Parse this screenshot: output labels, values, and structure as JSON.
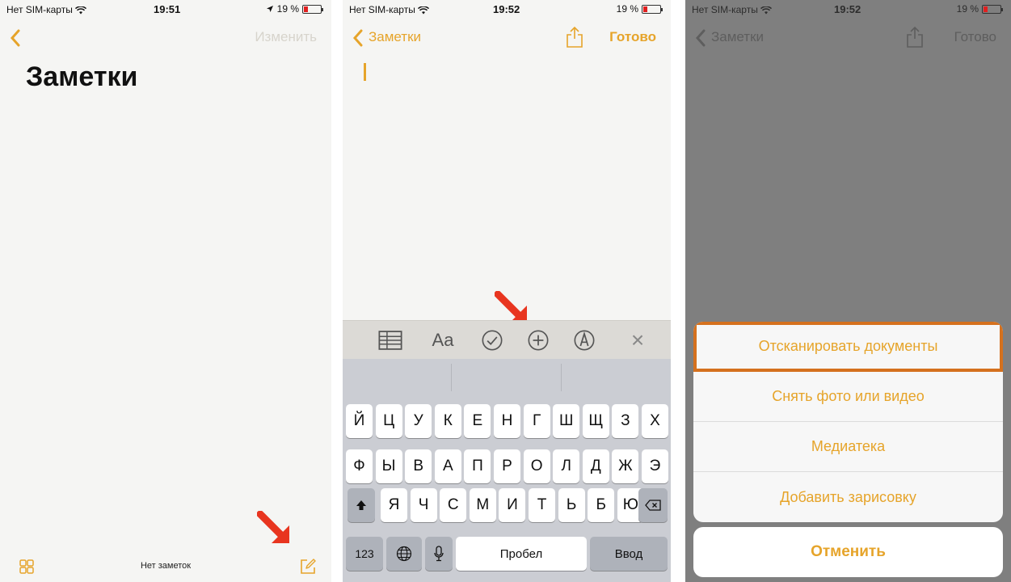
{
  "status": {
    "carrier": "Нет SIM-карты",
    "battery": "19 %",
    "time1": "19:51",
    "time2": "19:52",
    "time3": "19:52"
  },
  "screen1": {
    "edit_label": "Изменить",
    "title": "Заметки",
    "empty_label": "Нет заметок"
  },
  "screen2": {
    "back_label": "Заметки",
    "done_label": "Готово",
    "format_aa": "Aa",
    "keyboard": {
      "row1": [
        "Й",
        "Ц",
        "У",
        "К",
        "Е",
        "Н",
        "Г",
        "Ш",
        "Щ",
        "З",
        "Х"
      ],
      "row2": [
        "Ф",
        "Ы",
        "В",
        "А",
        "П",
        "Р",
        "О",
        "Л",
        "Д",
        "Ж",
        "Э"
      ],
      "row3": [
        "Я",
        "Ч",
        "С",
        "М",
        "И",
        "Т",
        "Ь",
        "Б",
        "Ю"
      ],
      "num_label": "123",
      "space_label": "Пробел",
      "return_label": "Ввод"
    }
  },
  "screen3": {
    "back_label": "Заметки",
    "done_label": "Готово",
    "sheet_items": [
      "Отсканировать документы",
      "Снять фото или видео",
      "Медиатека",
      "Добавить зарисовку"
    ],
    "cancel_label": "Отменить"
  },
  "colors": {
    "accent": "#e6a42a",
    "arrow": "#e8351f",
    "highlight": "#d5711e"
  }
}
